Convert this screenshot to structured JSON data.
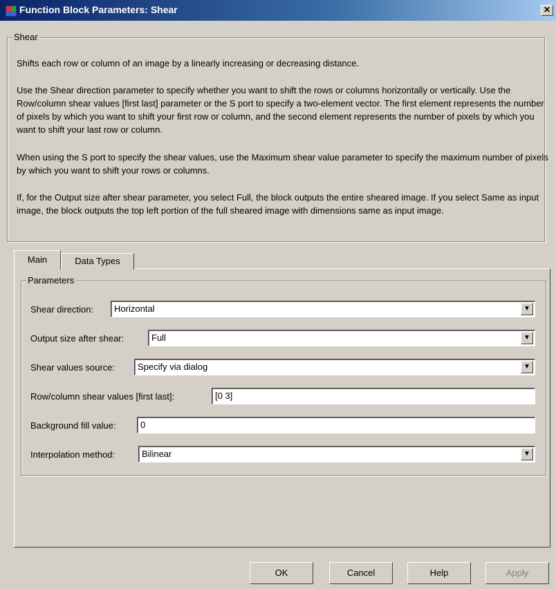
{
  "window": {
    "title": "Function Block Parameters: Shear"
  },
  "description": {
    "group_label": "Shear",
    "paragraphs": [
      "Shifts each row or column of an image by a linearly increasing or decreasing distance.",
      "Use the Shear direction parameter to specify whether you want to shift the rows or columns horizontally or vertically. Use the Row/column shear values [first last] parameter or the S port to specify a two-element vector. The first element represents the number of pixels by which you want to shift your first row or column, and the second element represents the number of pixels by which you want to shift your last row or column.",
      "When using the S port to specify the shear values, use the Maximum shear value parameter to specify the maximum number of pixels by which you want to shift your rows or columns.",
      "If, for the Output size after shear parameter, you select Full, the block outputs the entire sheared image. If you select Same as input image, the block outputs the top left portion of the full sheared image with dimensions same as input image."
    ]
  },
  "tabs": [
    {
      "label": "Main"
    },
    {
      "label": "Data Types"
    }
  ],
  "parameters": {
    "group_label": "Parameters",
    "shear_direction": {
      "label": "Shear direction:",
      "value": "Horizontal"
    },
    "output_size": {
      "label": "Output size after shear:",
      "value": "Full"
    },
    "shear_source": {
      "label": "Shear values source:",
      "value": "Specify via dialog"
    },
    "row_col_values": {
      "label": "Row/column shear values [first last]:",
      "value": "[0 3]"
    },
    "background_fill": {
      "label": "Background fill value:",
      "value": "0"
    },
    "interpolation": {
      "label": "Interpolation method:",
      "value": "Bilinear"
    }
  },
  "buttons": {
    "ok": "OK",
    "cancel": "Cancel",
    "help": "Help",
    "apply": "Apply"
  },
  "icons": {
    "app": "simulink-block-icon",
    "close": "close-icon",
    "dropdown": "chevron-down-icon"
  }
}
